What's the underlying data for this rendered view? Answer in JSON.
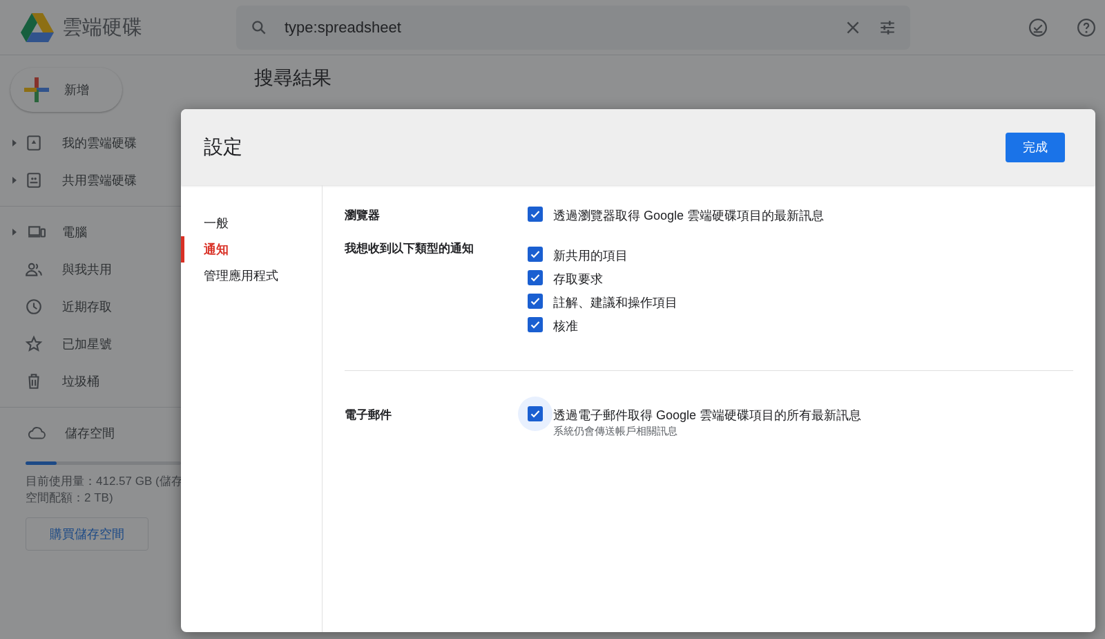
{
  "app": {
    "logo_text": "雲端硬碟",
    "search": {
      "value": "type:spreadsheet"
    },
    "new_button": "新增",
    "nav": [
      {
        "label": "我的雲端硬碟",
        "expandable": true
      },
      {
        "label": "共用雲端硬碟",
        "expandable": true
      },
      {
        "label": "電腦",
        "expandable": true
      },
      {
        "label": "與我共用",
        "expandable": false
      },
      {
        "label": "近期存取",
        "expandable": false
      },
      {
        "label": "已加星號",
        "expandable": false
      },
      {
        "label": "垃圾桶",
        "expandable": false
      }
    ],
    "storage": {
      "label": "儲存空間",
      "level": 0.2,
      "usage": "目前使用量：412.57 GB (儲存",
      "quota": "空間配額：2 TB)",
      "button": "購買儲存空間"
    },
    "page_title": "搜尋結果"
  },
  "dialog": {
    "title": "設定",
    "done_button": "完成",
    "nav": [
      {
        "label": "一般",
        "selected": false
      },
      {
        "label": "通知",
        "selected": true
      },
      {
        "label": "管理應用程式",
        "selected": false
      }
    ],
    "sections": [
      {
        "label": "瀏覽器",
        "divider_after": false,
        "options": [
          {
            "label": "透過瀏覽器取得 Google 雲端硬碟項目的最新訊息",
            "checked": true,
            "focused": false
          }
        ]
      },
      {
        "label": "我想收到以下類型的通知",
        "divider_after": true,
        "options": [
          {
            "label": "新共用的項目",
            "checked": true,
            "focused": false
          },
          {
            "label": "存取要求",
            "checked": true,
            "focused": false
          },
          {
            "label": "註解、建議和操作項目",
            "checked": true,
            "focused": false
          },
          {
            "label": "核准",
            "checked": true,
            "focused": false
          }
        ]
      },
      {
        "label": "電子郵件",
        "divider_after": false,
        "options": [
          {
            "label": "透過電子郵件取得 Google 雲端硬碟項目的所有最新訊息",
            "note": "系統仍會傳送帳戶相關訊息",
            "checked": true,
            "focused": true
          }
        ]
      }
    ]
  }
}
